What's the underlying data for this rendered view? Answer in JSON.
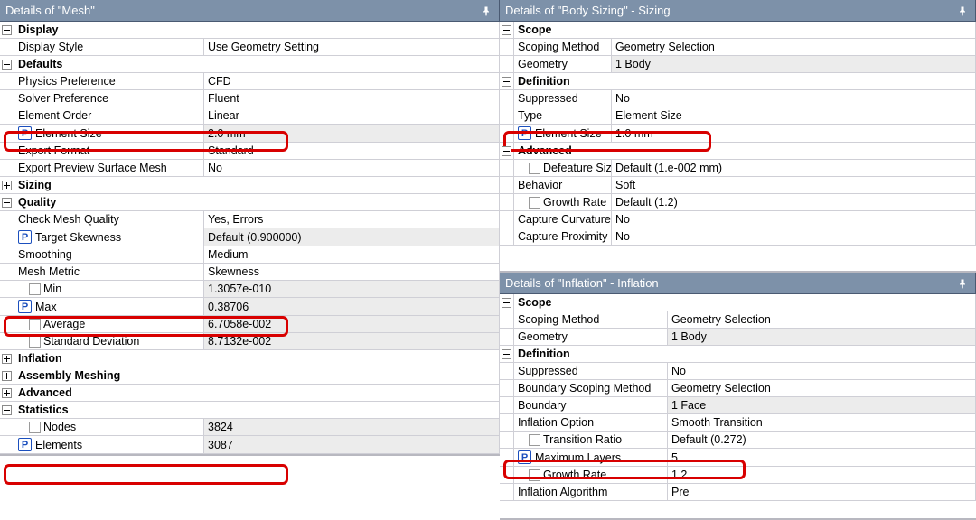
{
  "icons": {
    "pin": "pushpin"
  },
  "mesh": {
    "title": "Details of \"Mesh\"",
    "label_w": "210px",
    "groups": [
      {
        "name": "Display",
        "exp": "minus",
        "rows": [
          {
            "l": "Display Style",
            "v": "Use Geometry Setting"
          }
        ]
      },
      {
        "name": "Defaults",
        "exp": "minus",
        "rows": [
          {
            "l": "Physics Preference",
            "v": "CFD"
          },
          {
            "l": "Solver Preference",
            "v": "Fluent"
          },
          {
            "l": "Element Order",
            "v": "Linear"
          },
          {
            "l": "Element Size",
            "v": "2.0 mm",
            "p": true,
            "grey": true,
            "hl": true
          },
          {
            "l": "Export Format",
            "v": "Standard"
          },
          {
            "l": "Export Preview Surface Mesh",
            "v": "No"
          }
        ]
      },
      {
        "name": "Sizing",
        "exp": "plus",
        "rows": []
      },
      {
        "name": "Quality",
        "exp": "minus",
        "rows": [
          {
            "l": "Check Mesh Quality",
            "v": "Yes, Errors"
          },
          {
            "l": "Target Skewness",
            "v": "Default (0.900000)",
            "p": true,
            "grey": true
          },
          {
            "l": "Smoothing",
            "v": "Medium"
          },
          {
            "l": "Mesh Metric",
            "v": "Skewness"
          },
          {
            "l": "Min",
            "v": "1.3057e-010",
            "chk": true,
            "grey": true
          },
          {
            "l": "Max",
            "v": "0.38706",
            "p": true,
            "grey": true,
            "hl": true
          },
          {
            "l": "Average",
            "v": "6.7058e-002",
            "chk": true,
            "grey": true
          },
          {
            "l": "Standard Deviation",
            "v": "8.7132e-002",
            "chk": true,
            "grey": true
          }
        ]
      },
      {
        "name": "Inflation",
        "exp": "plus",
        "rows": []
      },
      {
        "name": "Assembly Meshing",
        "exp": "plus",
        "rows": []
      },
      {
        "name": "Advanced",
        "exp": "plus",
        "rows": []
      },
      {
        "name": "Statistics",
        "exp": "minus",
        "rows": [
          {
            "l": "Nodes",
            "v": "3824",
            "chk": true,
            "grey": true
          },
          {
            "l": "Elements",
            "v": "3087",
            "p": true,
            "grey": true,
            "hl": true
          }
        ]
      }
    ]
  },
  "body_sizing": {
    "title": "Details of \"Body Sizing\" - Sizing",
    "label_w": "108px",
    "groups": [
      {
        "name": "Scope",
        "exp": "minus",
        "rows": [
          {
            "l": "Scoping Method",
            "v": "Geometry Selection"
          },
          {
            "l": "Geometry",
            "v": "1 Body",
            "grey": true
          }
        ]
      },
      {
        "name": "Definition",
        "exp": "minus",
        "rows": [
          {
            "l": "Suppressed",
            "v": "No"
          },
          {
            "l": "Type",
            "v": "Element Size"
          },
          {
            "l": "Element Size",
            "v": "1.0 mm",
            "p": true,
            "hl": true
          },
          {
            "name_is_row_end": true
          }
        ]
      },
      {
        "name": "Advanced",
        "exp": "minus",
        "rows": [
          {
            "l": "Defeature Size",
            "v": "Default (1.e-002 mm)",
            "chk": true
          },
          {
            "l": "Behavior",
            "v": "Soft"
          },
          {
            "l": "Growth Rate",
            "v": "Default (1.2)",
            "chk": true
          },
          {
            "l": "Capture Curvature",
            "v": "No"
          },
          {
            "l": "Capture Proximity",
            "v": "No"
          }
        ]
      }
    ]
  },
  "inflation": {
    "title": "Details of \"Inflation\" - Inflation",
    "label_w": "170px",
    "groups": [
      {
        "name": "Scope",
        "exp": "minus",
        "rows": [
          {
            "l": "Scoping Method",
            "v": "Geometry Selection"
          },
          {
            "l": "Geometry",
            "v": "1 Body",
            "grey": true
          }
        ]
      },
      {
        "name": "Definition",
        "exp": "minus",
        "rows": [
          {
            "l": "Suppressed",
            "v": "No"
          },
          {
            "l": "Boundary Scoping Method",
            "v": "Geometry Selection"
          },
          {
            "l": "Boundary",
            "v": "1 Face",
            "grey": true
          },
          {
            "l": "Inflation Option",
            "v": "Smooth Transition"
          },
          {
            "l": "Transition Ratio",
            "v": "Default (0.272)",
            "chk": true
          },
          {
            "l": "Maximum Layers",
            "v": "5",
            "p": true,
            "hl": true
          },
          {
            "l": "Growth Rate",
            "v": "1.2",
            "chk": true
          },
          {
            "l": "Inflation Algorithm",
            "v": "Pre"
          }
        ]
      }
    ]
  }
}
